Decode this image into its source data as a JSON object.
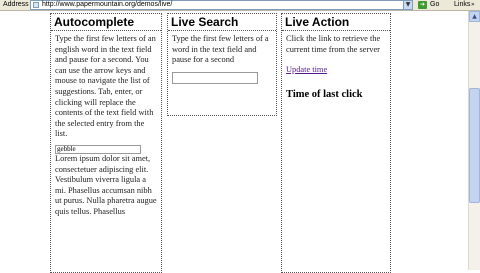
{
  "address_bar": {
    "label": "Address",
    "url": "http://www.papermountain.org/demos/live/",
    "go_label": "Go",
    "links_label": "Links",
    "links_chevron": "»"
  },
  "columns": {
    "autocomplete": {
      "title": "Autocomplete",
      "description": "Type the first few letters of an english word in the text field and pause for a second. You can use the arrow keys and mouse to navigate the list of suggestions. Tab, enter, or clicking will replace the contents of the text field with the selected entry from the list.",
      "input_value": "gebble",
      "lorem": "Lorem ipsum dolor sit amet, consectetuer adipiscing elit. Vestibulum viverra ligula a mi. Phasellus accumsan nibh ut purus. Nulla pharetra augue quis tellus. Phasellus"
    },
    "live_search": {
      "title": "Live Search",
      "description": "Type the first few letters of a word in the text field and pause for a second",
      "input_value": ""
    },
    "live_action": {
      "title": "Live Action",
      "description": "Click the link to retrieve the current time from the server",
      "link_text": "Update time",
      "result_heading": "Time of last click"
    }
  }
}
